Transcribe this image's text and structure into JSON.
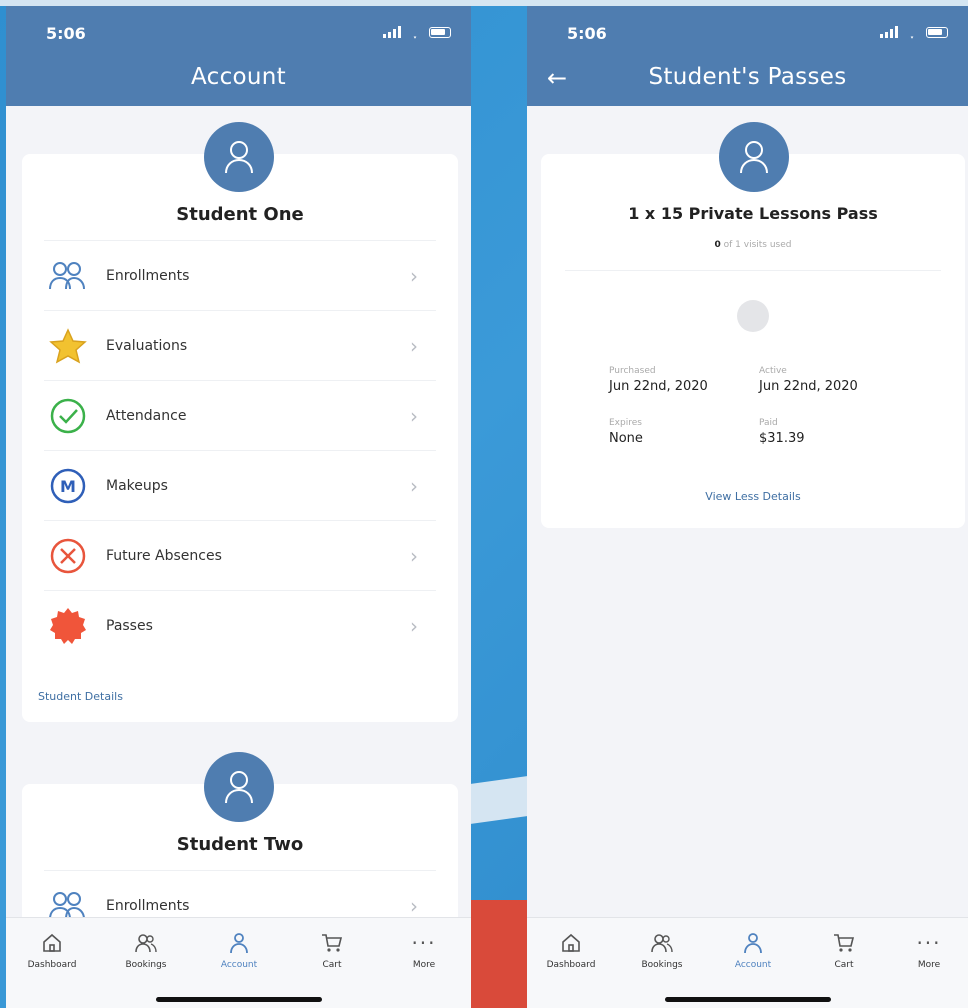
{
  "left": {
    "status_time": "5:06",
    "title": "Account",
    "student_one": {
      "name": "Student One",
      "items": [
        {
          "label": "Enrollments",
          "icon": "enrollments-icon"
        },
        {
          "label": "Evaluations",
          "icon": "star-icon"
        },
        {
          "label": "Attendance",
          "icon": "check-circle-icon"
        },
        {
          "label": "Makeups",
          "icon": "makeup-m-icon"
        },
        {
          "label": "Future Absences",
          "icon": "x-circle-icon"
        },
        {
          "label": "Passes",
          "icon": "badge-icon"
        }
      ],
      "details_link": "Student Details"
    },
    "student_two": {
      "name": "Student Two",
      "first_item": {
        "label": "Enrollments",
        "icon": "enrollments-icon"
      }
    },
    "tabs": [
      "Dashboard",
      "Bookings",
      "Account",
      "Cart",
      "More"
    ],
    "active_tab": "Account"
  },
  "right": {
    "status_time": "5:06",
    "title": "Student's Passes",
    "pass": {
      "name": "1 x 15 Private Lessons Pass",
      "visits_used_count": "0",
      "visits_used_text": "of 1 visits used",
      "purchased_label": "Purchased",
      "purchased_value": "Jun 22nd, 2020",
      "active_label": "Active",
      "active_value": "Jun 22nd, 2020",
      "expires_label": "Expires",
      "expires_value": "None",
      "paid_label": "Paid",
      "paid_value": "$31.39",
      "details_toggle": "View Less Details"
    },
    "tabs": [
      "Dashboard",
      "Bookings",
      "Account",
      "Cart",
      "More"
    ],
    "active_tab": "Account"
  },
  "colors": {
    "header": "#4f7db0",
    "accent": "#4f82bf",
    "star": "#f2c230",
    "attendance": "#3bb14a",
    "makeups": "#2f5fb8",
    "absences": "#e8553c",
    "passes": "#f0553a"
  }
}
